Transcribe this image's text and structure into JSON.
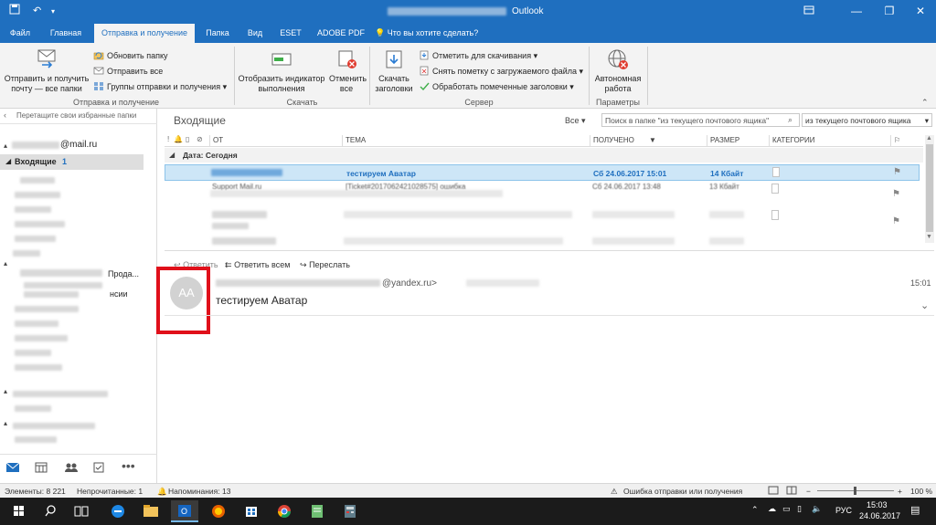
{
  "window": {
    "title": "Outlook",
    "blurred_title_prefix": true
  },
  "tabs": [
    {
      "label": "Файл"
    },
    {
      "label": "Главная"
    },
    {
      "label": "Отправка и получение",
      "active": true
    },
    {
      "label": "Папка"
    },
    {
      "label": "Вид"
    },
    {
      "label": "ESET"
    },
    {
      "label": "ADOBE PDF"
    },
    {
      "label": "Что вы хотите сделать?"
    }
  ],
  "ribbon": {
    "send_receive_all": "Отправить и получить почту — все папки",
    "update_folder": "Обновить папку",
    "send_all": "Отправить все",
    "send_receive_groups": "Группы отправки и получения",
    "group_send_receive": "Отправка и получение",
    "show_progress": "Отобразить индикатор выполнения",
    "cancel_all": "Отменить все",
    "group_download": "Скачать",
    "download_headers": "Скачать заголовки",
    "mark_to_download": "Отметить для скачивания",
    "unmark_downloaded": "Снять пометку с загружаемого файла",
    "process_marked": "Обработать помеченные заголовки",
    "group_server": "Сервер",
    "work_offline": "Автономная работа",
    "group_params": "Параметры"
  },
  "folders": {
    "favorites_hint": "Перетащите свои избранные папки",
    "account": "@mail.ru",
    "inbox": "Входящие",
    "inbox_count": "1",
    "truncated_1": "Прода...",
    "truncated_2": "нсии"
  },
  "list": {
    "folder_title": "Входящие",
    "filter_all": "Все",
    "search_placeholder": "Поиск в папке \"из текущего почтового ящика\"",
    "scope": "из текущего почтового ящика",
    "columns": {
      "from": "ОТ",
      "subject": "ТЕМА",
      "received": "ПОЛУЧЕНО",
      "size": "РАЗМЕР",
      "categories": "КАТЕГОРИИ"
    },
    "group_header": "Дата: Сегодня",
    "rows": [
      {
        "from": "",
        "subject": "тестируем Аватар",
        "received": "Сб 24.06.2017 15:01",
        "size": "14 Кбайт",
        "selected": true
      },
      {
        "from": "Support Mail.ru",
        "subject": "[Ticket#2017062421028575] ошибка",
        "received": "Сб 24.06.2017 13:48",
        "size": "13 Кбайт",
        "selected": false
      }
    ]
  },
  "reading": {
    "reply": "Ответить",
    "reply_all": "Ответить всем",
    "forward": "Переслать",
    "avatar_initials": "AA",
    "sender_email": "@yandex.ru>",
    "time": "15:01",
    "subject": "тестируем Аватар"
  },
  "status": {
    "items": "Элементы: 8 221",
    "unread": "Непрочитанные: 1",
    "reminders": "Напоминания: 13",
    "error": "Ошибка отправки или получения",
    "zoom": "100 %"
  },
  "taskbar": {
    "lang": "РУС",
    "time": "15:03",
    "date": "24.06.2017"
  },
  "colors": {
    "accent": "#1f6fbf",
    "highlight_box": "#e0101a",
    "selected_row": "#cde6f7"
  }
}
